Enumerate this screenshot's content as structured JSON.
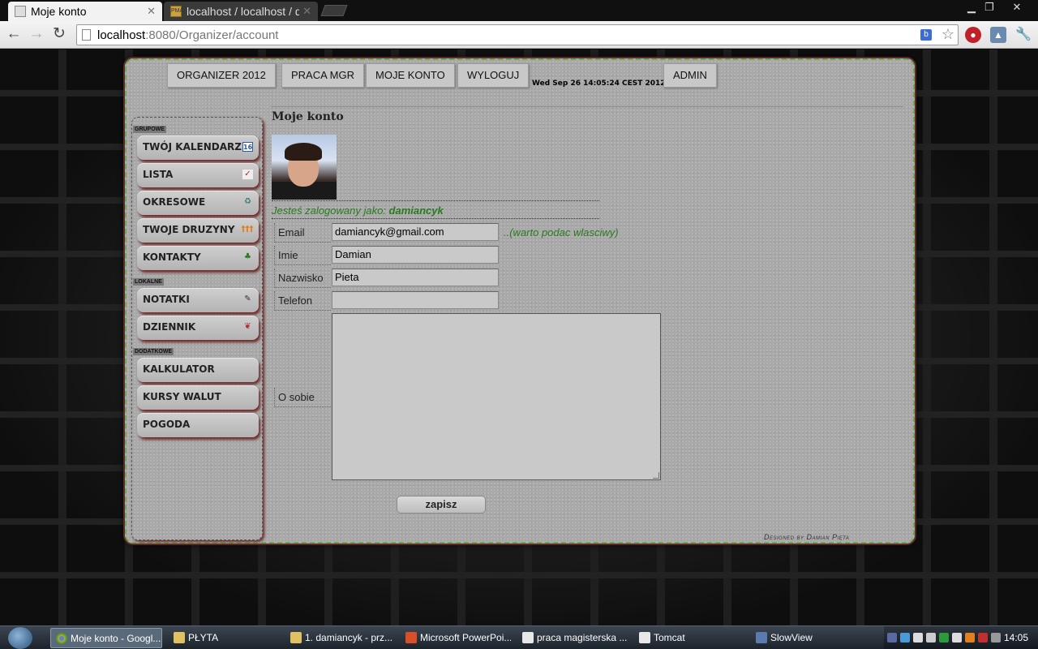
{
  "browser": {
    "tabs": [
      {
        "title": "Moje konto",
        "active": true
      },
      {
        "title": "localhost / localhost / db_",
        "active": false
      }
    ],
    "tab_favicon_text": "PMA",
    "url_host": "localhost",
    "url_rest": ":8080/Organizer/account",
    "ext_letter": "b"
  },
  "topnav": {
    "items": [
      "ORGANIZER 2012",
      "PRACA MGR",
      "MOJE KONTO",
      "WYLOGUJ",
      "ADMIN"
    ],
    "datetime": "Wed Sep 26 14:05:24 CEST 2012"
  },
  "sidebar": {
    "sections": [
      {
        "label": "GRUPOWE",
        "items": [
          "TWÓJ KALENDARZ",
          "LISTA",
          "OKRESOWE",
          "TWOJE DRUZYNY",
          "KONTAKTY"
        ]
      },
      {
        "label": "LOKALNE",
        "items": [
          "NOTATKI",
          "DZIENNIK"
        ]
      },
      {
        "label": "DODATKOWE",
        "items": [
          "KALKULATOR",
          "KURSY WALUT",
          "POGODA"
        ]
      }
    ],
    "icon_glyphs": {
      "calendar": "16",
      "list": "✓",
      "recurring": "♻",
      "teams": "†††",
      "contacts": "♣",
      "notes": "✎",
      "journal": "❦"
    }
  },
  "content": {
    "title": "Moje konto",
    "logged_prefix": "Jesteś zalogowany jako: ",
    "username": "damiancyk",
    "form": {
      "email_label": "Email",
      "email_value": "damiancyk@gmail.com",
      "email_hint": "..(warto podac wlasciwy)",
      "first_name_label": "Imie",
      "first_name_value": "Damian",
      "last_name_label": "Nazwisko",
      "last_name_value": "Pieta",
      "phone_label": "Telefon",
      "phone_value": "",
      "about_label": "O sobie",
      "about_value": ""
    },
    "save_label": "zapisz",
    "credit": "Designed by Damian Pięta"
  },
  "taskbar": {
    "tasks": [
      "Moje konto - Googl...",
      "PŁYTA",
      "1. damiancyk - prz...",
      "Microsoft PowerPoi...",
      "praca magisterska ...",
      "Tomcat",
      "SlowView"
    ],
    "clock": "14:05"
  },
  "colors": {
    "accent_green": "#2a7a1f",
    "panel_gray": "#a9a9a9",
    "border_green": "#6fa84f"
  }
}
